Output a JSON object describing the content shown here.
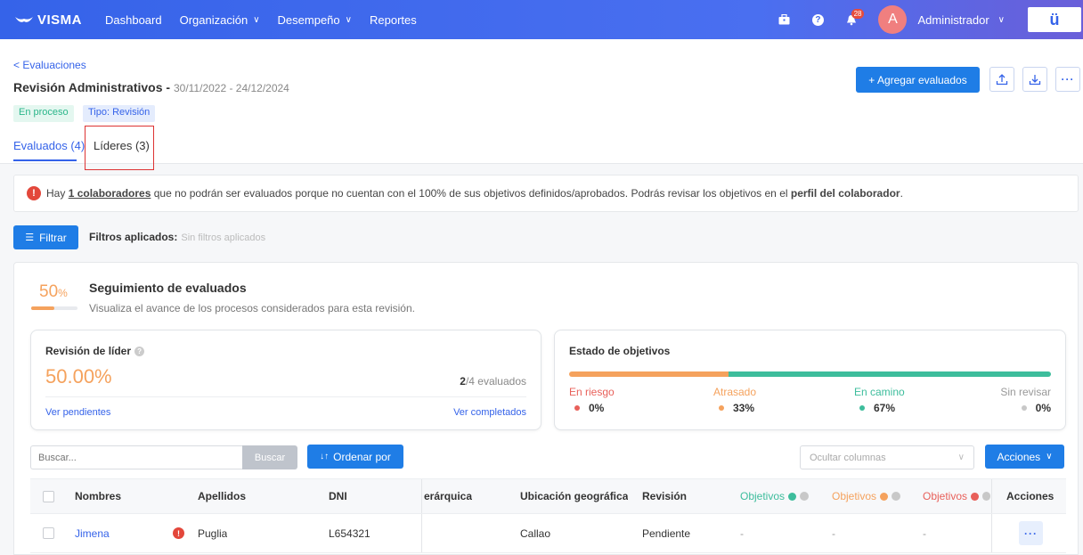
{
  "nav": {
    "logo": "VISMA",
    "items": [
      {
        "label": "Dashboard",
        "has_dropdown": false
      },
      {
        "label": "Organización",
        "has_dropdown": true
      },
      {
        "label": "Desempeño",
        "has_dropdown": true
      },
      {
        "label": "Reportes",
        "has_dropdown": false
      }
    ],
    "notifications_count": "28",
    "avatar_letter": "A",
    "user_name": "Administrador",
    "app_logo": "ü"
  },
  "header": {
    "back_link": "< Evaluaciones",
    "title": "Revisión Administrativos - ",
    "dates": "30/11/2022 - 24/12/2024",
    "status_badge": "En proceso",
    "type_badge": "Tipo: Revisión",
    "tabs": [
      {
        "label": "Evaluados (4)",
        "active": true
      },
      {
        "label": "Líderes (3)",
        "active": false
      }
    ],
    "add_button": "+ Agregar evaluados",
    "icons": [
      "upload-icon",
      "download-icon",
      "more-icon"
    ]
  },
  "alert": {
    "prefix": "Hay ",
    "link": "1 colaboradores",
    "middle": " que no podrán ser evaluados porque no cuentan con el 100% de sus objetivos definidos/aprobados. Podrás revisar los objetivos en el ",
    "bold": "perfil del colaborador",
    "suffix": "."
  },
  "filter": {
    "button": "Filtrar",
    "label": "Filtros aplicados:",
    "value": "Sin filtros aplicados"
  },
  "tracking": {
    "percent": "50",
    "percent_unit": "%",
    "progress": 0.5,
    "title": "Seguimiento de evaluados",
    "subtitle": "Visualiza el avance de los procesos considerados para esta revisión."
  },
  "leader_review": {
    "title": "Revisión de líder",
    "percent": "50.00%",
    "done": "2",
    "total_text": "/4 evaluados",
    "link_pending": "Ver pendientes",
    "link_completed": "Ver completados"
  },
  "objectives": {
    "title": "Estado de objetivos",
    "items": [
      {
        "label": "En riesgo",
        "value": "0%",
        "fraction": 0.0,
        "color": "#e8605a"
      },
      {
        "label": "Atrasado",
        "value": "33%",
        "fraction": 0.33,
        "color": "#f5a25d"
      },
      {
        "label": "En camino",
        "value": "67%",
        "fraction": 0.67,
        "color": "#3dbd9c"
      },
      {
        "label": "Sin revisar",
        "value": "0%",
        "fraction": 0.0,
        "color": "#c8c8c8"
      }
    ]
  },
  "controls": {
    "search_placeholder": "Buscar...",
    "search_button": "Buscar",
    "sort_button": "Ordenar por",
    "columns_placeholder": "Ocultar columnas",
    "actions_button": "Acciones"
  },
  "table": {
    "headers": {
      "names": "Nombres",
      "surnames": "Apellidos",
      "dni": "DNI",
      "hierarchy": "erárquica",
      "location": "Ubicación geográfica",
      "review": "Revisión",
      "obj_green": "Objetivos",
      "obj_orange": "Objetivos",
      "obj_red": "Objetivos",
      "actions": "Acciones"
    },
    "header_colors": {
      "green": "#3dbd9c",
      "orange": "#f5a25d",
      "red": "#e8605a"
    },
    "rows": [
      {
        "name": "Jimena",
        "surname": "Puglia",
        "dni": "L654321",
        "hierarchy": "",
        "location": "Callao",
        "review": "Pendiente",
        "obj_green": "-",
        "obj_orange": "-",
        "obj_red": "-"
      }
    ]
  }
}
